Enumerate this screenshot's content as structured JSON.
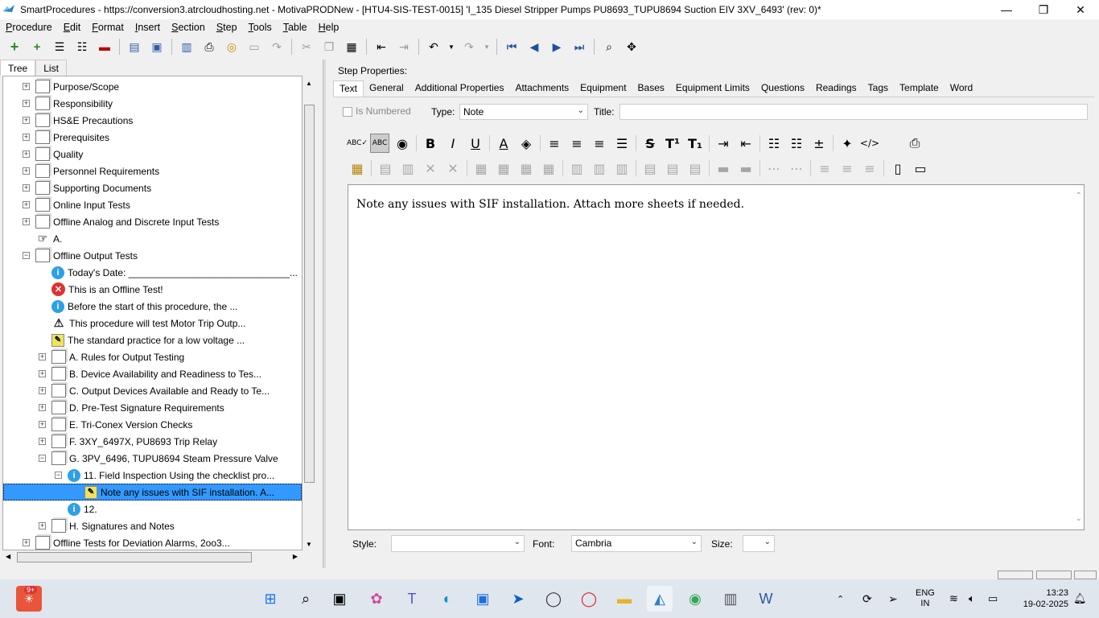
{
  "window": {
    "title": "SmartProcedures - https://conversion3.atrcloudhosting.net - MotivaPRODNew - [HTU4-SIS-TEST-0015] 'I_135 Diesel Stripper Pumps PU8693_TUPU8694 Suction EIV 3XV_6493' (rev: 0)*",
    "minimize": "—",
    "maximize": "❐",
    "close": "✕"
  },
  "menu": [
    {
      "label": "Procedure",
      "key": "P",
      "rest": "rocedure"
    },
    {
      "label": "Edit",
      "key": "E",
      "rest": "dit"
    },
    {
      "label": "Format",
      "key": "F",
      "rest": "ormat"
    },
    {
      "label": "Insert",
      "key": "I",
      "rest": "nsert"
    },
    {
      "label": "Section",
      "key": "S",
      "rest": "ection"
    },
    {
      "label": "Step",
      "key": "S",
      "rest": "tep"
    },
    {
      "label": "Tools",
      "key": "T",
      "rest": "ools"
    },
    {
      "label": "Table",
      "key": "T",
      "rest": "able"
    },
    {
      "label": "Help",
      "key": "H",
      "rest": "elp"
    }
  ],
  "left_tabs": [
    "Tree",
    "List"
  ],
  "tree": [
    {
      "label": "Purpose/Scope",
      "icon": "section-icon",
      "exp": "+",
      "level": 0
    },
    {
      "label": "Responsibility",
      "icon": "section-icon",
      "exp": "+",
      "level": 0
    },
    {
      "label": "HS&E Precautions",
      "icon": "section-icon",
      "exp": "+",
      "level": 0
    },
    {
      "label": "Prerequisites",
      "icon": "section-icon",
      "exp": "+",
      "level": 0
    },
    {
      "label": "Quality",
      "icon": "section-icon",
      "exp": "+",
      "level": 0
    },
    {
      "label": "Personnel Requirements",
      "icon": "section-icon",
      "exp": "+",
      "level": 0
    },
    {
      "label": "Supporting Documents",
      "icon": "section-icon",
      "exp": "+",
      "level": 0
    },
    {
      "label": "Online Input Tests",
      "icon": "section-icon",
      "exp": "+",
      "level": 0
    },
    {
      "label": "Offline Analog and Discrete Input Tests",
      "icon": "section-icon",
      "exp": "+",
      "level": 0
    },
    {
      "label": "A.",
      "icon": "pointer-hand-icon",
      "exp": "",
      "level": 0
    },
    {
      "label": "Offline Output Tests",
      "icon": "section-icon",
      "exp": "−",
      "level": 0
    },
    {
      "label": "Today's Date: ______________________________...",
      "icon": "info-icon",
      "exp": "",
      "level": 1
    },
    {
      "label": "This is an Offline Test!",
      "icon": "error-icon",
      "exp": "",
      "level": 1
    },
    {
      "label": "Before the start of this procedure, the ...",
      "icon": "info-icon",
      "exp": "",
      "level": 1
    },
    {
      "label": "This procedure will test Motor Trip Outp...",
      "icon": "warning-icon",
      "exp": "",
      "level": 1
    },
    {
      "label": "The standard practice for a low voltage ...",
      "icon": "note-icon",
      "exp": "",
      "level": 1
    },
    {
      "label": "A. Rules for Output Testing",
      "icon": "section-icon",
      "exp": "+",
      "level": 1
    },
    {
      "label": "B. Device Availability and Readiness to Tes...",
      "icon": "section-icon",
      "exp": "+",
      "level": 1
    },
    {
      "label": "C. Output Devices Available and Ready to Te...",
      "icon": "section-icon",
      "exp": "+",
      "level": 1
    },
    {
      "label": "D. Pre-Test Signature Requirements",
      "icon": "section-icon",
      "exp": "+",
      "level": 1
    },
    {
      "label": "E. Tri-Conex Version Checks",
      "icon": "section-icon",
      "exp": "+",
      "level": 1
    },
    {
      "label": "F. 3XY_6497X, PU8693 Trip Relay",
      "icon": "section-icon",
      "exp": "+",
      "level": 1
    },
    {
      "label": "G. 3PV_6496, TUPU8694 Steam Pressure Valve",
      "icon": "section-icon",
      "exp": "−",
      "level": 1
    },
    {
      "label": "11. Field Inspection Using the checklist pro...",
      "icon": "info-icon",
      "exp": "−",
      "level": 2
    },
    {
      "label": "Note any issues with SIF installation. A...",
      "icon": "note-icon",
      "exp": "",
      "level": 3,
      "selected": true
    },
    {
      "label": "12.",
      "icon": "info-icon",
      "exp": "",
      "level": 2
    },
    {
      "label": "H. Signatures and Notes",
      "icon": "section-icon",
      "exp": "+",
      "level": 1
    },
    {
      "label": "Offline Tests for Deviation Alarms, 2oo3...",
      "icon": "section-icon",
      "exp": "+",
      "level": 0
    }
  ],
  "step_properties_label": "Step Properties:",
  "right_tabs": [
    "Text",
    "General",
    "Additional Properties",
    "Attachments",
    "Equipment",
    "Bases",
    "Equipment Limits",
    "Questions",
    "Readings",
    "Tags",
    "Template",
    "Word"
  ],
  "props": {
    "is_numbered_label": "Is Numbered",
    "type_label": "Type:",
    "type_value": "Note",
    "title_label": "Title:",
    "title_value": ""
  },
  "editor": {
    "text": "Note any issues with SIF installation. Attach more sheets if needed."
  },
  "stylebar": {
    "style_label": "Style:",
    "style_value": "",
    "font_label": "Font:",
    "font_value": "Cambria",
    "size_label": "Size:",
    "size_value": ""
  },
  "taskbar": {
    "notification_count": "9+",
    "language": "ENG",
    "region": "IN",
    "time": "13:23",
    "date": "19-02-2025"
  }
}
